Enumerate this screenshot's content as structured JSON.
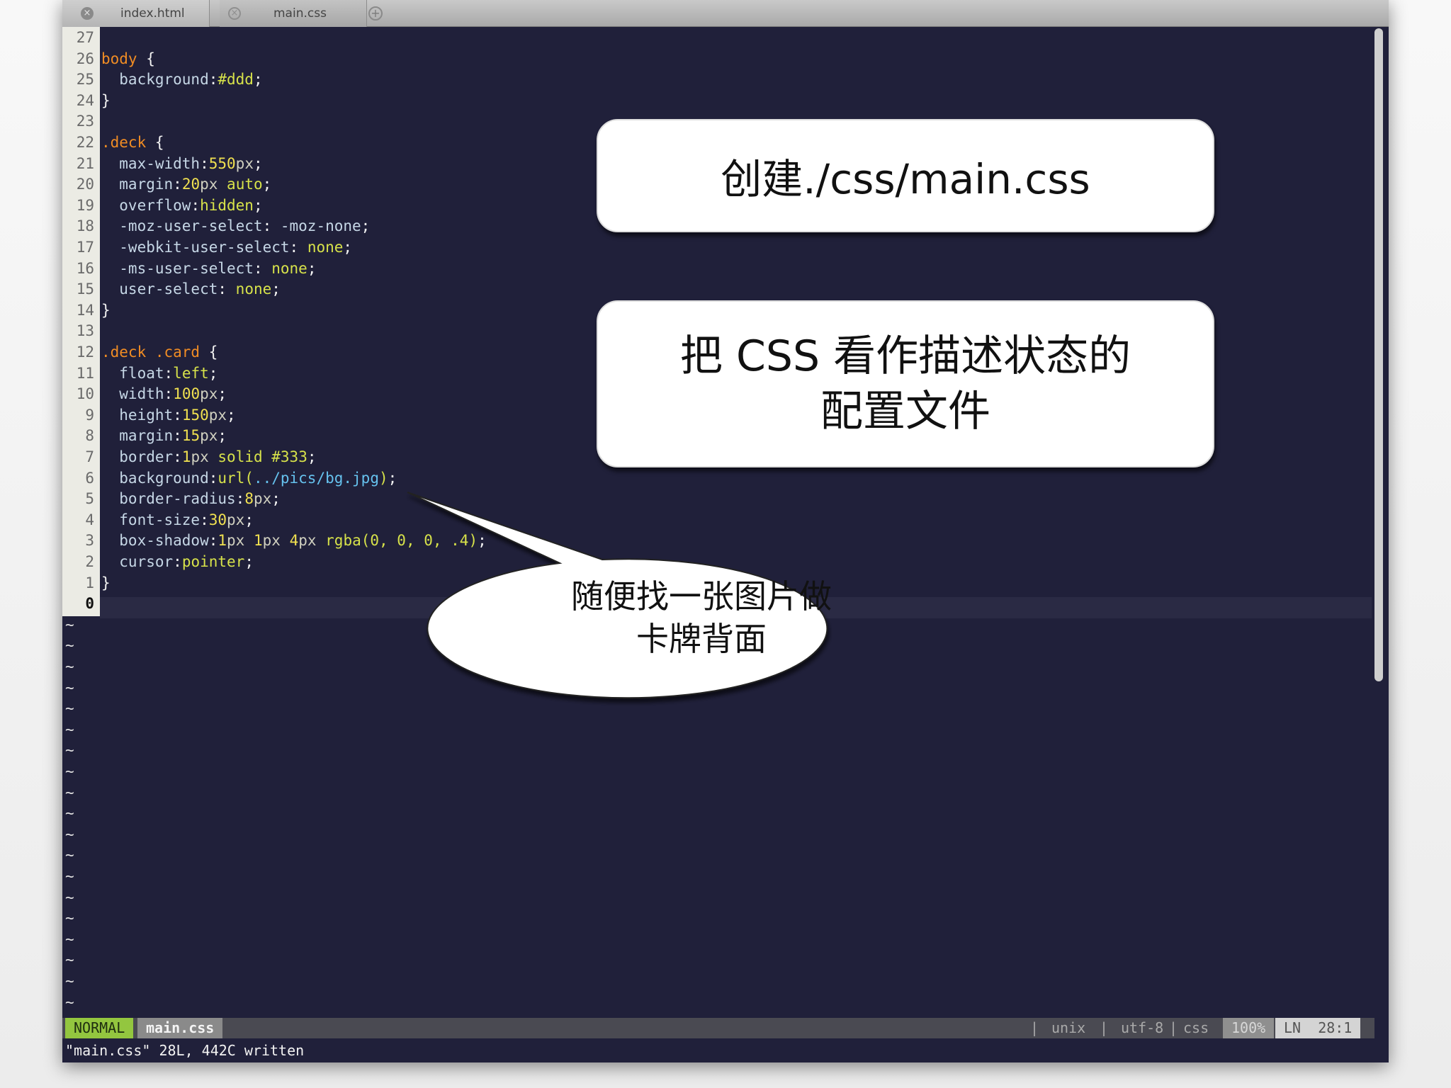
{
  "tabs": [
    {
      "label": "index.html",
      "close": "×"
    },
    {
      "label": "main.css",
      "close": "×"
    }
  ],
  "new_tab_icon": "+",
  "line_numbers": [
    "27",
    "26",
    "25",
    "24",
    "23",
    "22",
    "21",
    "20",
    "19",
    "18",
    "17",
    "16",
    "15",
    "14",
    "13",
    "12",
    "11",
    "10",
    "9",
    "8",
    "7",
    "6",
    "5",
    "4",
    "3",
    "2",
    "1",
    "0"
  ],
  "code": {
    "l26": [
      "body",
      " {"
    ],
    "l25": [
      "  background",
      ":",
      "#ddd",
      ";"
    ],
    "l24": [
      "}"
    ],
    "l22": [
      ".deck",
      " {"
    ],
    "l21": [
      "  max-width",
      ":",
      "550",
      "px",
      ";"
    ],
    "l20": [
      "  margin",
      ":",
      "20",
      "px",
      " auto",
      ";"
    ],
    "l19": [
      "  overflow",
      ":",
      "hidden",
      ";"
    ],
    "l18": [
      "  -moz-user-select",
      ": ",
      "-moz-none",
      ";"
    ],
    "l17": [
      "  -webkit-user-select",
      ": ",
      "none",
      ";"
    ],
    "l16": [
      "  -ms-user-select",
      ": ",
      "none",
      ";"
    ],
    "l15": [
      "  user-select",
      ": ",
      "none",
      ";"
    ],
    "l14": [
      "}"
    ],
    "l12": [
      ".deck .card",
      " {"
    ],
    "l11": [
      "  float",
      ":",
      "left",
      ";"
    ],
    "l10": [
      "  width",
      ":",
      "100",
      "px",
      ";"
    ],
    "l9": [
      "  height",
      ":",
      "150",
      "px",
      ";"
    ],
    "l8": [
      "  margin",
      ":",
      "15",
      "px",
      ";"
    ],
    "l7": [
      "  border",
      ":",
      "1",
      "px",
      " solid #333",
      ";"
    ],
    "l6": [
      "  background",
      ":",
      "url(",
      "../pics/bg.jpg",
      ")",
      ";"
    ],
    "l5": [
      "  border-radius",
      ":",
      "8",
      "px",
      ";"
    ],
    "l4": [
      "  font-size",
      ":",
      "30",
      "px",
      ";"
    ],
    "l3": [
      "  box-shadow",
      ":",
      "1",
      "px ",
      "1",
      "px ",
      "4",
      "px ",
      "rgba(0, 0, 0, .4)",
      ";"
    ],
    "l2": [
      "  cursor",
      ":",
      "pointer",
      ";"
    ],
    "l1": [
      "}"
    ]
  },
  "tilde": "~",
  "status": {
    "mode": "NORMAL",
    "filename": "main.css",
    "fileformat": "unix",
    "encoding": "utf-8",
    "filetype": "css",
    "percent": "100%",
    "ln_label": "LN",
    "position": "28:1",
    "separator": "|"
  },
  "message": "\"main.css\" 28L, 442C written",
  "annotations": {
    "box1": "创建./css/main.css",
    "box2_line1": "把 CSS 看作描述状态的",
    "box2_line2": "配置文件",
    "bubble_line1": "随便找一张图片做",
    "bubble_line2": "卡牌背面"
  },
  "colors": {
    "editor_bg": "#20203a",
    "selector": "#f08c24",
    "value": "#d7e24a",
    "string": "#66c2ee",
    "mode_bg": "#93c63f"
  }
}
